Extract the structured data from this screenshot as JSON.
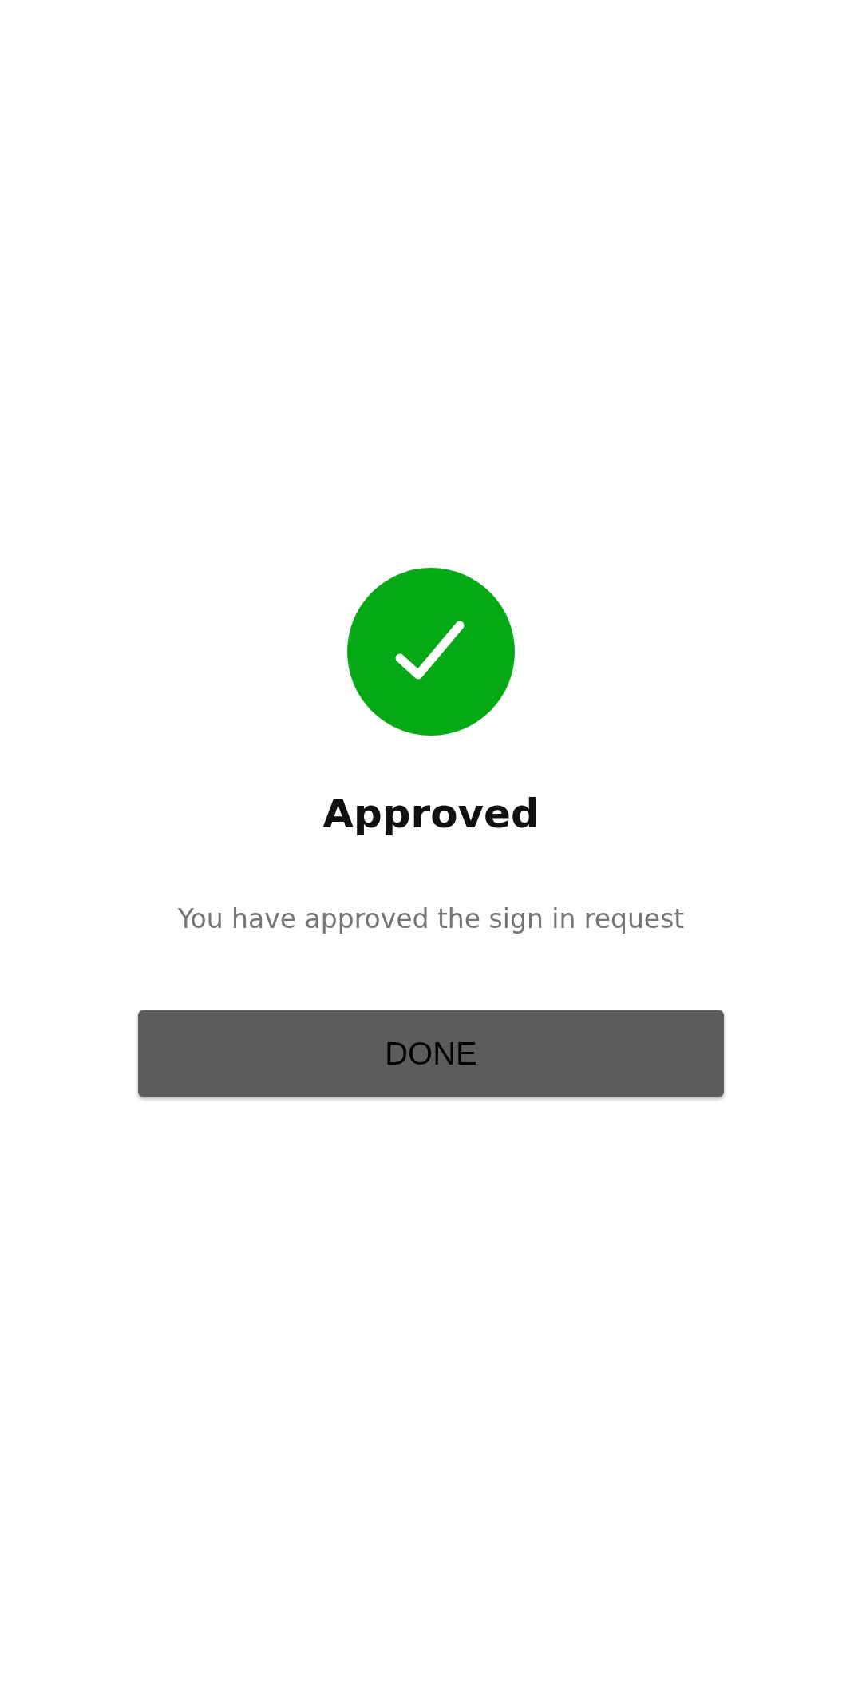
{
  "status": {
    "title": "Approved",
    "message": "You have approved the sign in request",
    "approved": true
  },
  "button": {
    "label": "DONE"
  }
}
